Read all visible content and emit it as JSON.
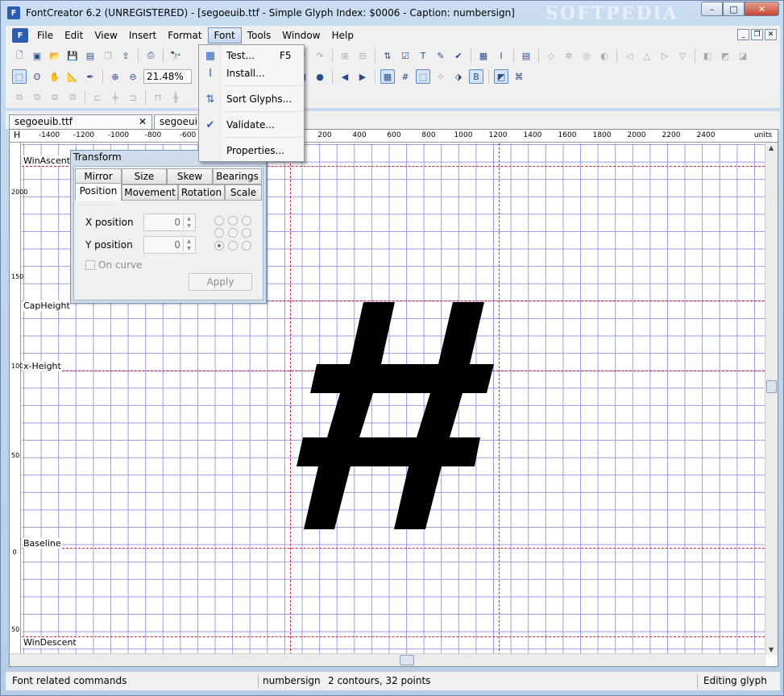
{
  "window": {
    "title": "FontCreator 6.2 (UNREGISTERED) - [segoeuib.ttf - Simple Glyph Index: $0006 - Caption: numbersign]",
    "watermark": "SOFTPEDIA",
    "minimize": "–",
    "maximize": "□",
    "close": "✕"
  },
  "menubar": {
    "items": [
      "File",
      "Edit",
      "View",
      "Insert",
      "Format",
      "Font",
      "Tools",
      "Window",
      "Help"
    ],
    "active": "Font"
  },
  "toolbar": {
    "zoom_value": "21.48%"
  },
  "font_menu": {
    "items": [
      {
        "label": "Test...",
        "shortcut": "F5",
        "icon": "test-icon"
      },
      {
        "label": "Install...",
        "shortcut": "",
        "icon": "install-icon"
      },
      {
        "label": "Sort Glyphs...",
        "shortcut": "",
        "icon": "sort-icon"
      },
      {
        "label": "Validate...",
        "shortcut": "",
        "icon": "checkmark-icon"
      },
      {
        "label": "Properties...",
        "shortcut": "",
        "icon": "none"
      }
    ]
  },
  "tabs": [
    {
      "label": "segoeuib.ttf",
      "close": "✕"
    },
    {
      "label": "segoeuib",
      "close": ""
    }
  ],
  "ruler": {
    "corner": "H",
    "x_labels": [
      "-1400",
      "-1200",
      "-1000",
      "-800",
      "-600",
      "200",
      "400",
      "600",
      "800",
      "1000",
      "1200",
      "1400",
      "1600",
      "1800",
      "2000",
      "2200",
      "2400"
    ],
    "units": "units",
    "v_labels": [
      "2000",
      "150",
      "1000",
      "50",
      "0",
      "50"
    ]
  },
  "metrics": {
    "win_ascent": "WinAscent",
    "cap_height": "CapHeight",
    "x_height": "x-Height",
    "baseline": "Baseline",
    "win_descent": "WinDescent"
  },
  "transform_panel": {
    "title": "Transform",
    "tabs_row1": [
      "Mirror",
      "Size",
      "Skew",
      "Bearings"
    ],
    "tabs_row2": [
      "Position",
      "Movement",
      "Rotation",
      "Scale"
    ],
    "active_tab": "Position",
    "x_label": "X position",
    "x_value": "0",
    "y_label": "Y position",
    "y_value": "0",
    "on_curve_label": "On curve",
    "apply_label": "Apply"
  },
  "statusbar": {
    "hint": "Font related commands",
    "glyph_name": "numbersign",
    "contours": "2 contours, 32 points",
    "mode": "Editing glyph"
  },
  "colors": {
    "grid": "#9a9ae6",
    "guide": "#cc2244",
    "glyph": "#000000"
  }
}
